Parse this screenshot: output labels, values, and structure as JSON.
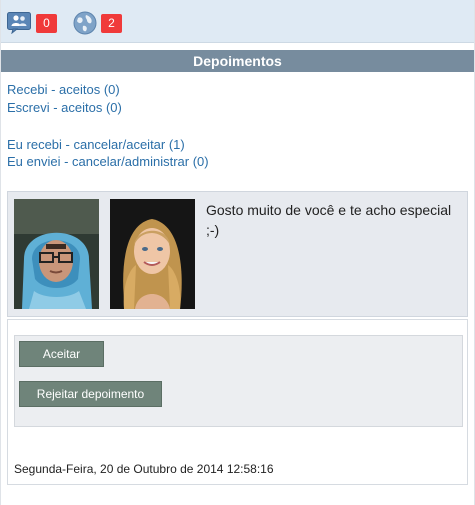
{
  "topbar": {
    "friends_icon": "friend-requests-icon",
    "friends_count": "0",
    "globe_icon": "globe-icon",
    "notifications_count": "2"
  },
  "section": {
    "title": "Depoimentos"
  },
  "links": {
    "received_accepted": "Recebi - aceitos (0)",
    "wrote_accepted": "Escrevi - aceitos (0)",
    "received_pending": "Eu recebi - cancelar/aceitar (1)",
    "sent_pending": "Eu enviei - cancelar/administrar (0)"
  },
  "testimonial": {
    "text": "Gosto muito de você e te acho especial ;-)"
  },
  "actions": {
    "accept_label": "Aceitar",
    "reject_label": "Rejeitar depoimento"
  },
  "date": "Segunda-Feira, 20 de Outubro de 2014 12:58:16",
  "colors": {
    "header_bg": "#778c9e",
    "badge_bg": "#f03a3a",
    "link": "#2b6fa8",
    "button_bg": "#6f847a"
  }
}
